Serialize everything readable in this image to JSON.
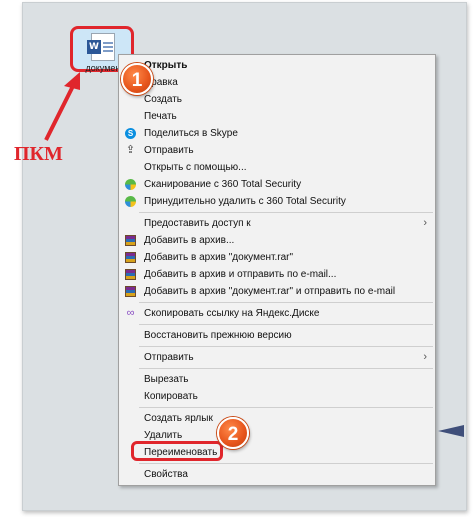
{
  "file": {
    "label": "документ",
    "icon": "word-document-icon"
  },
  "annotations": {
    "rmb_label": "ПКМ",
    "step1": "1",
    "step2": "2",
    "highlight_color": "#e0262c",
    "badge_color": "#e6541b"
  },
  "menu": {
    "items": [
      {
        "label": "Открыть",
        "bold": true,
        "icon": ""
      },
      {
        "label": "Правка",
        "icon": ""
      },
      {
        "label": "Создать",
        "icon": ""
      },
      {
        "label": "Печать",
        "icon": ""
      },
      {
        "label": "Поделиться в Skype",
        "icon": "skype-icon"
      },
      {
        "label": "Отправить",
        "icon": "share-icon"
      },
      {
        "label": "Открыть с помощью...",
        "icon": ""
      },
      {
        "label": "Сканирование с 360 Total Security",
        "icon": "360-security-icon"
      },
      {
        "label": "Принудительно удалить с  360 Total Security",
        "icon": "360-security-icon"
      },
      {
        "label": "Предоставить доступ к",
        "icon": "",
        "submenu": true
      },
      {
        "label": "Добавить в архив...",
        "icon": "winrar-icon"
      },
      {
        "label": "Добавить в архив \"документ.rar\"",
        "icon": "winrar-icon"
      },
      {
        "label": "Добавить в архив и отправить по e-mail...",
        "icon": "winrar-icon"
      },
      {
        "label": "Добавить в архив \"документ.rar\" и отправить по e-mail",
        "icon": "winrar-icon"
      },
      {
        "label": "Скопировать ссылку на Яндекс.Диске",
        "icon": "yandex-disk-link-icon"
      },
      {
        "label": "Восстановить прежнюю версию",
        "icon": ""
      },
      {
        "label": "Отправить",
        "icon": "",
        "submenu": true
      },
      {
        "label": "Вырезать",
        "icon": ""
      },
      {
        "label": "Копировать",
        "icon": ""
      },
      {
        "label": "Создать ярлык",
        "icon": ""
      },
      {
        "label": "Удалить",
        "icon": ""
      },
      {
        "label": "Переименовать",
        "icon": ""
      },
      {
        "label": "Свойства",
        "icon": ""
      }
    ],
    "submenu_arrow": "›"
  }
}
